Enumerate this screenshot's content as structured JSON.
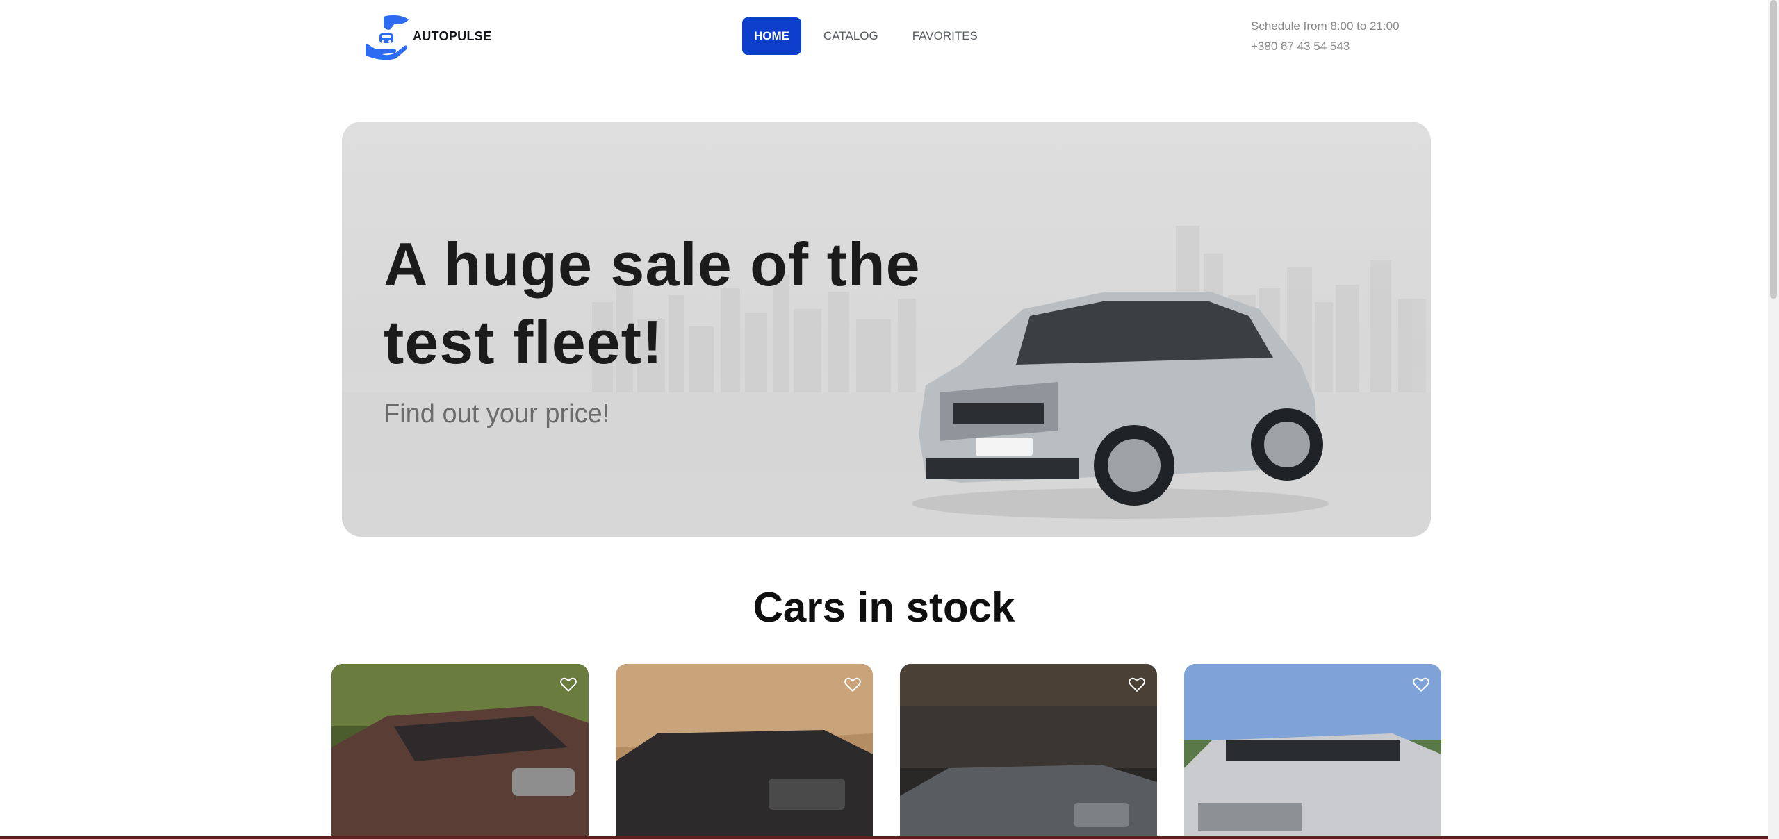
{
  "header": {
    "brand": "AUTOPULSE",
    "nav": [
      {
        "label": "HOME",
        "active": true
      },
      {
        "label": "CATALOG",
        "active": false
      },
      {
        "label": "FAVORITES",
        "active": false
      }
    ],
    "schedule": "Schedule from 8:00 to 21:00",
    "phone": "+380 67 43 54 543"
  },
  "hero": {
    "title": "A huge sale of the test fleet!",
    "subtitle": "Find out your price!"
  },
  "stock": {
    "title": "Cars in stock",
    "cards": [
      {
        "icon": "heart-outline-icon"
      },
      {
        "icon": "heart-outline-icon"
      },
      {
        "icon": "heart-outline-icon"
      },
      {
        "icon": "heart-outline-icon"
      }
    ]
  },
  "colors": {
    "accent": "#0d3fcc",
    "logo": "#2d6cf0",
    "hero_bg": "#dcdcdc"
  }
}
